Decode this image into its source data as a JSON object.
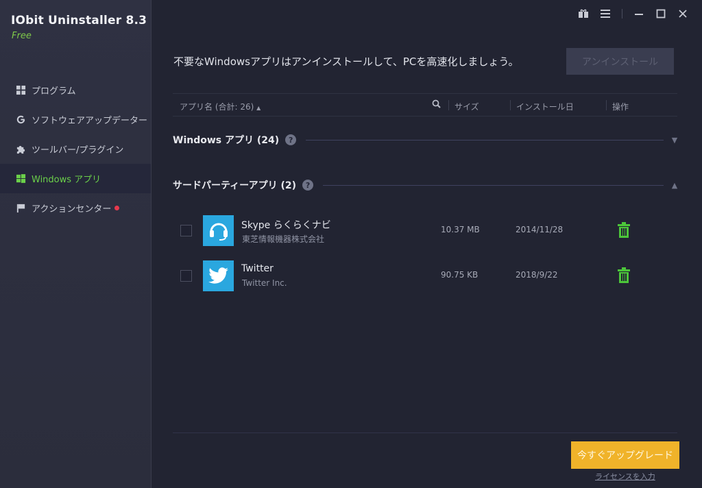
{
  "app": {
    "title": "IObit Uninstaller 8.3",
    "edition": "Free"
  },
  "nav": [
    {
      "label": "プログラム",
      "icon": "grid-icon"
    },
    {
      "label": "ソフトウェアアップデーター",
      "icon": "refresh-icon"
    },
    {
      "label": "ツールバー/プラグイン",
      "icon": "puzzle-icon"
    },
    {
      "label": "Windows アプリ",
      "icon": "windows-icon",
      "active": true
    },
    {
      "label": "アクションセンター",
      "icon": "flag-icon",
      "notification": true
    }
  ],
  "header": {
    "headline": "不要なWindowsアプリはアンインストールして、PCを高速化しましょう。",
    "uninstall_button": "アンインストール"
  },
  "columns": {
    "name": "アプリ名 (合計: 26)",
    "size": "サイズ",
    "install_date": "インストール日",
    "action": "操作"
  },
  "groups": [
    {
      "title": "Windows アプリ (24)",
      "expanded": false
    },
    {
      "title": "サードパーティーアプリ (2)",
      "expanded": true
    }
  ],
  "apps": [
    {
      "name": "Skype らくらくナビ",
      "publisher": "東芝情報機器株式会社",
      "size": "10.37 MB",
      "date": "2014/11/28",
      "icon": "skype-navi-icon"
    },
    {
      "name": "Twitter",
      "publisher": "Twitter Inc.",
      "size": "90.75 KB",
      "date": "2018/9/22",
      "icon": "twitter-bird-icon"
    }
  ],
  "footer": {
    "upgrade_button": "今すぐアップグレード",
    "license_link": "ライセンスを入力"
  },
  "colors": {
    "accent_green": "#6bd04a",
    "upgrade": "#f0b32a",
    "app_icon_bg": "#2aa7df",
    "notification": "#e6394d"
  }
}
